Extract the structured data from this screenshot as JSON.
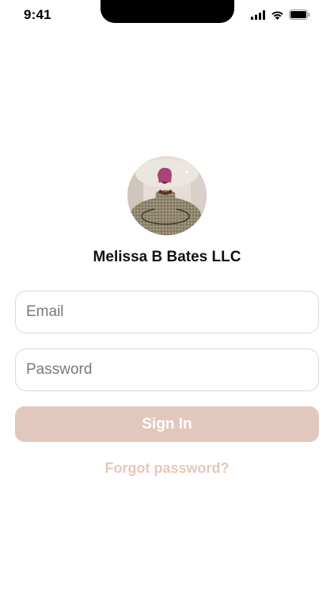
{
  "status_bar": {
    "time": "9:41",
    "icons": [
      "cellular-signal-icon",
      "wifi-icon",
      "battery-icon"
    ]
  },
  "profile": {
    "name": "Melissa B Bates LLC"
  },
  "form": {
    "email_placeholder": "Email",
    "email_value": "",
    "password_placeholder": "Password",
    "password_value": "",
    "sign_in_label": "Sign In",
    "forgot_label": "Forgot password?"
  },
  "colors": {
    "accent": "#e2c8bc",
    "link": "#e6c7b9",
    "border": "#d9d9d9"
  }
}
